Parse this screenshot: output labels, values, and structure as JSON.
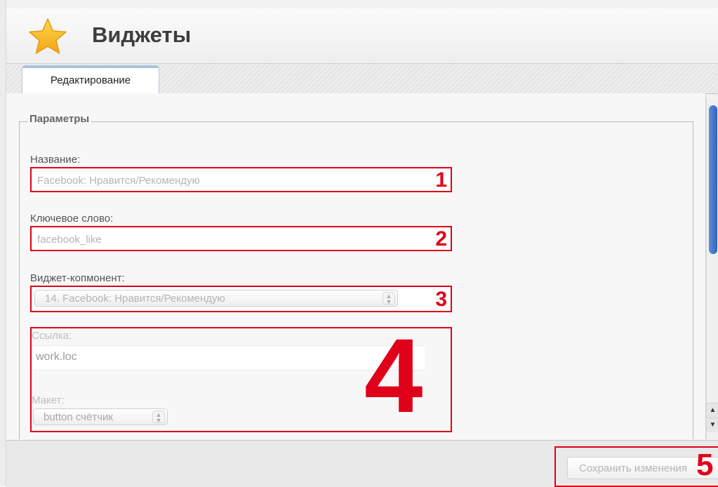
{
  "header": {
    "title": "Виджеты",
    "icon": "star-icon"
  },
  "tabs": [
    {
      "label": "Редактирование"
    }
  ],
  "fieldset": {
    "legend": "Параметры"
  },
  "fields": {
    "name": {
      "label": "Название:",
      "value": "Facebook: Нравится/Рекомендую",
      "marker": "1"
    },
    "keyword": {
      "label": "Ключевое слово:",
      "value": "facebook_like",
      "marker": "2"
    },
    "component": {
      "label": "Виджет-копмонент:",
      "value": "14. Facebook: Нравится/Рекомендую",
      "marker": "3"
    },
    "component_settings": {
      "marker": "4",
      "link_label": "Ссылка:",
      "link_value": "work.loc",
      "layout_label": "Макет:",
      "layout_value": "button счётчик"
    }
  },
  "footer": {
    "save_label": "Сохранить изменения",
    "marker": "5"
  },
  "colors": {
    "highlight": "#e0001a",
    "scroll_thumb": "#3f73cc"
  }
}
